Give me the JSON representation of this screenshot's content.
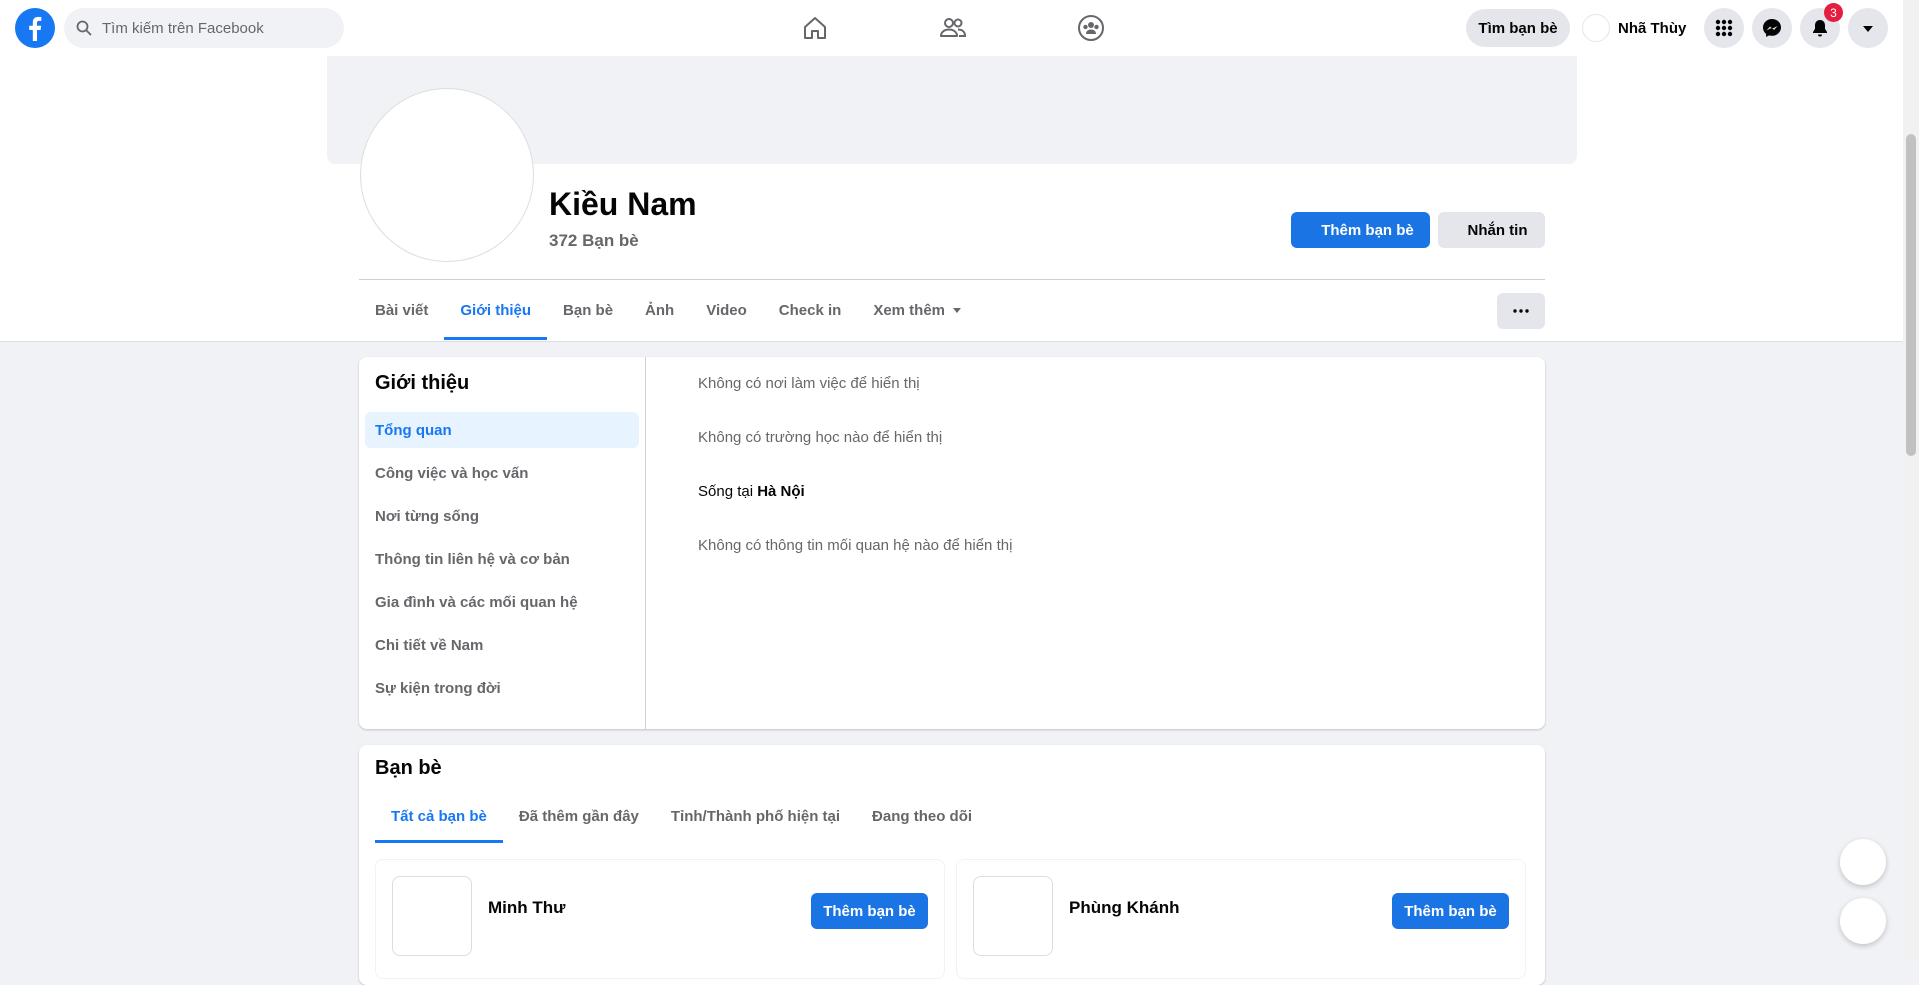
{
  "colors": {
    "brand": "#1877f2",
    "button_primary": "#1b74e4",
    "notification_badge": "#e41e3f",
    "page_background": "#f0f2f5",
    "muted_text": "#65676b"
  },
  "topbar": {
    "logo_icon": "facebook-logo-icon",
    "search_placeholder": "Tìm kiếm trên Facebook",
    "nav_icons": [
      "home-icon",
      "friends-icon",
      "groups-icon"
    ],
    "find_friends_label": "Tìm bạn bè",
    "user_name": "Nhã Thùy",
    "menu_icons": [
      "apps-grid-icon",
      "messenger-icon",
      "notifications-icon",
      "account-caret-icon"
    ],
    "notification_count": "3"
  },
  "profile": {
    "name": "Kiều Nam",
    "friends_count": "372 Bạn bè",
    "add_friend_label": "Thêm bạn bè",
    "message_label": "Nhắn tin",
    "tabs": [
      "Bài viết",
      "Giới thiệu",
      "Bạn bè",
      "Ảnh",
      "Video",
      "Check in",
      "Xem thêm"
    ],
    "active_tab": "Giới thiệu",
    "more_label": "···"
  },
  "about": {
    "title": "Giới thiệu",
    "nav_items": [
      "Tổng quan",
      "Công việc và học vấn",
      "Nơi từng sống",
      "Thông tin liên hệ và cơ bản",
      "Gia đình và các mối quan hệ",
      "Chi tiết về Nam",
      "Sự kiện trong đời"
    ],
    "active_item": "Tổng quan",
    "work": "Không có nơi làm việc để hiển thị",
    "school": "Không có trường học nào để hiển thị",
    "lives_prefix": "Sống tại ",
    "lives_city": "Hà Nội",
    "relationship": "Không có thông tin mối quan hệ nào để hiển thị"
  },
  "friends": {
    "title": "Bạn bè",
    "tabs": [
      "Tất cả bạn bè",
      "Đã thêm gần đây",
      "Tỉnh/Thành phố hiện tại",
      "Đang theo dõi"
    ],
    "active_tab": "Tất cả bạn bè",
    "list": [
      {
        "name": "Minh Thư",
        "button": "Thêm bạn bè"
      },
      {
        "name": "Phùng Khánh",
        "button": "Thêm bạn bè"
      }
    ]
  }
}
